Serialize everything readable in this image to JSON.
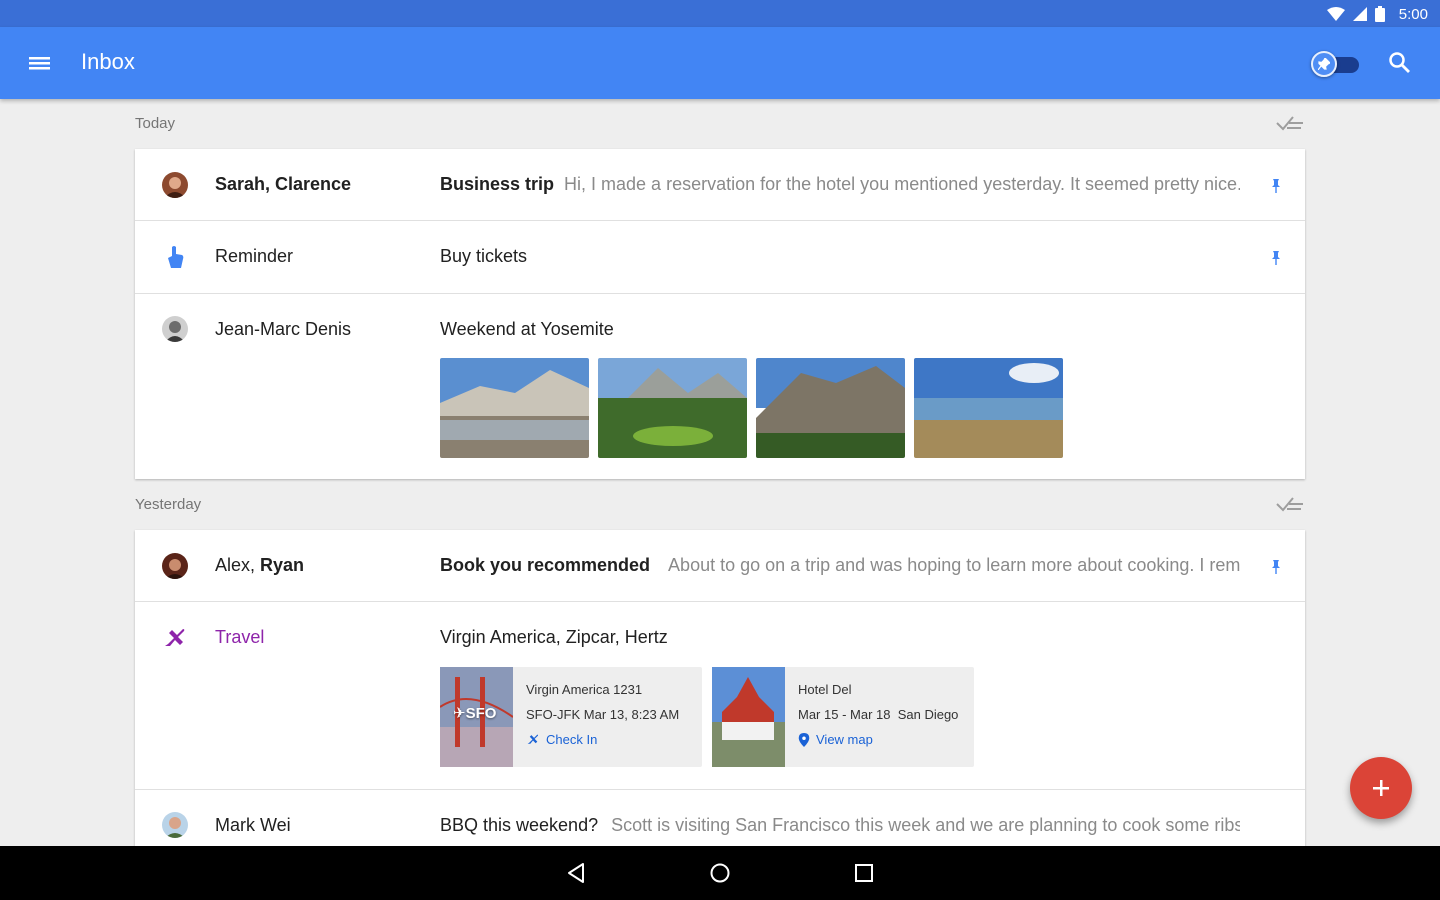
{
  "status": {
    "time": "5:00",
    "wifi_icon": "wifi-icon",
    "signal_icon": "signal-icon",
    "battery_icon": "battery-icon"
  },
  "app_bar": {
    "title": "Inbox",
    "menu_icon": "menu-icon",
    "pin_toggle_icon": "pin-icon",
    "search_icon": "search-icon",
    "color": "#4285f4"
  },
  "sections": [
    {
      "label": "Today",
      "items": [
        {
          "sender_plain": "",
          "sender_bold": "Sarah, Clarence",
          "subject": "Business trip",
          "subject_bold": true,
          "snippet": "Hi, I made a reservation for the hotel you mentioned yesterday. It seemed pretty nice...",
          "pinned": true
        },
        {
          "sender_plain": "Reminder",
          "sender_bold": "",
          "subject": "Buy tickets",
          "subject_bold": false,
          "snippet": "",
          "pinned": true
        },
        {
          "sender_plain": "Jean-Marc Denis",
          "sender_bold": "",
          "subject": "Weekend at Yosemite",
          "subject_bold": false,
          "snippet": "",
          "pinned": false,
          "photo_count": 4
        }
      ]
    },
    {
      "label": "Yesterday",
      "items": [
        {
          "sender_plain": "Alex, ",
          "sender_bold": "Ryan",
          "subject": "Book you recommended",
          "subject_bold": true,
          "snippet": "About to go on a trip and was hoping to learn more about cooking. I rem...",
          "pinned": true
        },
        {
          "sender_plain": "Travel",
          "sender_bold": "",
          "subject": "Virgin America, Zipcar, Hertz",
          "subject_bold": false,
          "snippet": "",
          "pinned": false,
          "color": "#8e24aa",
          "cards": [
            {
              "image_label": "SFO",
              "title": "Virgin America 1231",
              "detail": "SFO-JFK Mar 13, 8:23 AM",
              "action": "Check In",
              "action_icon": "airplane-icon"
            },
            {
              "image_label": "",
              "title": "Hotel Del",
              "detail": "Mar 15 - Mar 18  San Diego",
              "action": "View map",
              "action_icon": "map-pin-icon"
            }
          ]
        },
        {
          "sender_plain": "Mark Wei",
          "sender_bold": "",
          "subject": "BBQ this weekend?",
          "subject_bold": false,
          "snippet": "Scott is visiting San Francisco this week and we are planning to cook some ribs ...",
          "pinned": false
        }
      ]
    }
  ],
  "fab": {
    "icon": "plus-icon",
    "color": "#db4437"
  },
  "nav": {
    "back_icon": "back-icon",
    "home_icon": "home-icon",
    "recents_icon": "recents-icon"
  }
}
